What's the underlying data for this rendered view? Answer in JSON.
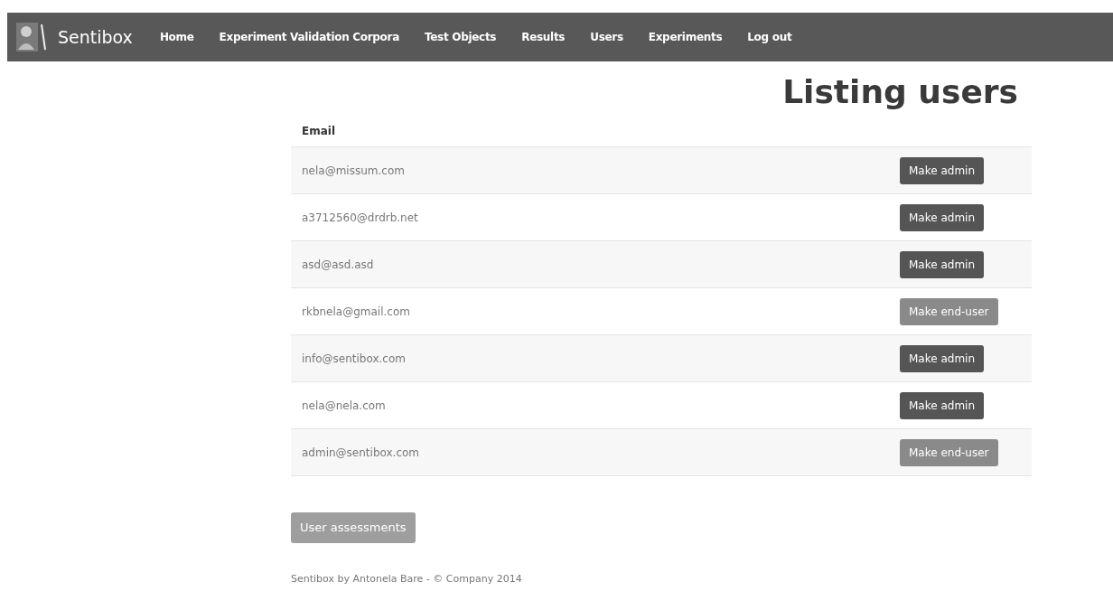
{
  "navbar": {
    "brand": "Sentibox",
    "items": [
      "Home",
      "Experiment Validation Corpora",
      "Test Objects",
      "Results",
      "Users",
      "Experiments",
      "Log out"
    ]
  },
  "title": "Listing users",
  "table": {
    "columns": [
      "Email"
    ],
    "rows": [
      {
        "email": "nela@missum.com",
        "action": {
          "label": "Make admin",
          "kind": "admin"
        }
      },
      {
        "email": "a3712560@drdrb.net",
        "action": {
          "label": "Make admin",
          "kind": "admin"
        }
      },
      {
        "email": "asd@asd.asd",
        "action": {
          "label": "Make admin",
          "kind": "admin"
        }
      },
      {
        "email": "rkbnela@gmail.com",
        "action": {
          "label": "Make end-user",
          "kind": "end-user"
        }
      },
      {
        "email": "info@sentibox.com",
        "action": {
          "label": "Make admin",
          "kind": "admin"
        }
      },
      {
        "email": "nela@nela.com",
        "action": {
          "label": "Make admin",
          "kind": "admin"
        }
      },
      {
        "email": "admin@sentibox.com",
        "action": {
          "label": "Make end-user",
          "kind": "end-user"
        }
      }
    ]
  },
  "assessments_button": "User assessments",
  "footer": "Sentibox by Antonela Bare - © Company 2014"
}
